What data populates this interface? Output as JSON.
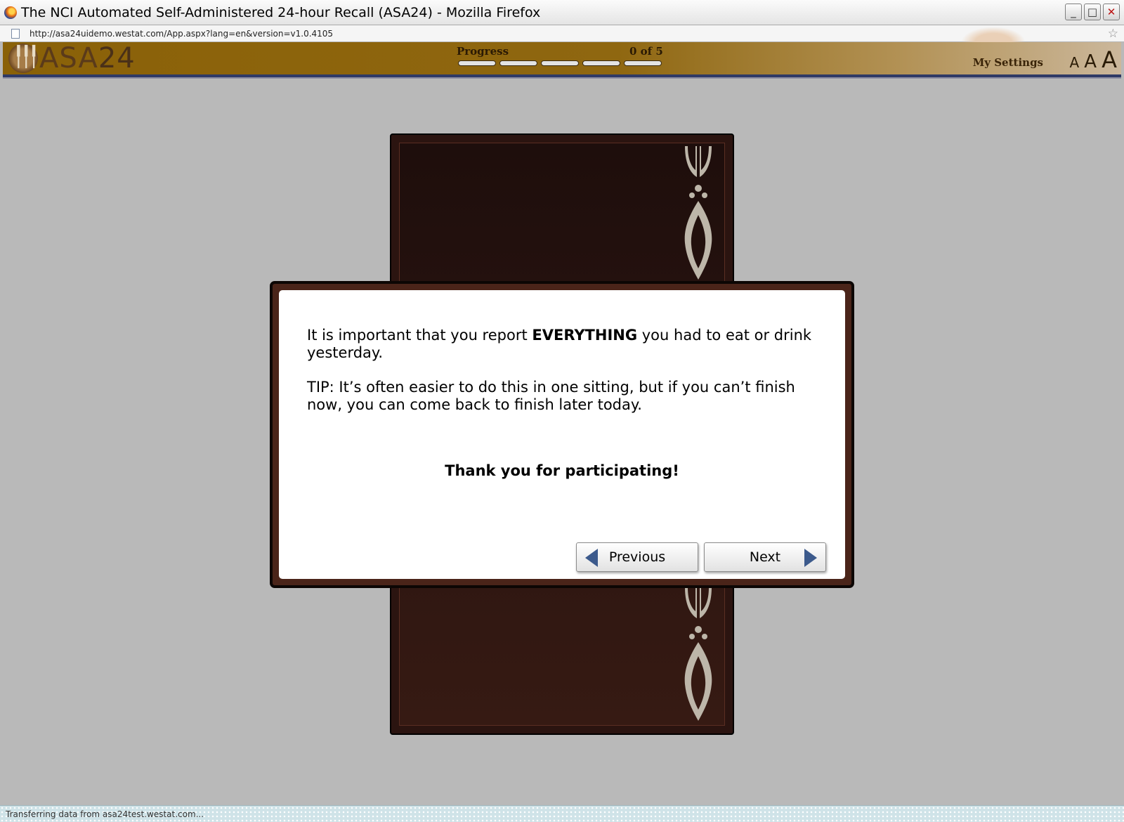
{
  "window": {
    "title": "The NCI Automated Self-Administered 24-hour Recall (ASA24) - Mozilla Firefox",
    "minimize": "_",
    "maximize": "□",
    "close": "✕"
  },
  "urlbar": {
    "url": "http://asa24uidemo.westat.com/App.aspx?lang=en&version=v1.0.4105"
  },
  "header": {
    "logo_asa": "ASA",
    "logo_num": "24",
    "progress_label": "Progress",
    "progress_count": "0 of 5",
    "progress": {
      "completed": 0,
      "total": 5
    },
    "settings_label": "My Settings",
    "font_sizes": [
      "A",
      "A",
      "A"
    ]
  },
  "dialog": {
    "line1_pre": "It is important that you report ",
    "line1_bold": "EVERYTHING",
    "line1_post": " you had to eat or drink yesterday.",
    "tip": "TIP: It’s often easier to do this in one sitting, but if you can’t finish now, you can come back to finish later today.",
    "thanks": "Thank you for participating!",
    "previous_label": "Previous",
    "next_label": "Next"
  },
  "status": {
    "text": "Transferring data from asa24test.westat.com..."
  },
  "colors": {
    "header_brown": "#8a6108",
    "menu_brown": "#2b1410",
    "arrow_blue": "#3c5a8c",
    "background_gray": "#b9b9b9"
  },
  "icons": [
    "firefox-icon",
    "page-icon",
    "bookmark-star-icon",
    "previous-arrow-icon",
    "next-arrow-icon",
    "ornament-icon"
  ]
}
